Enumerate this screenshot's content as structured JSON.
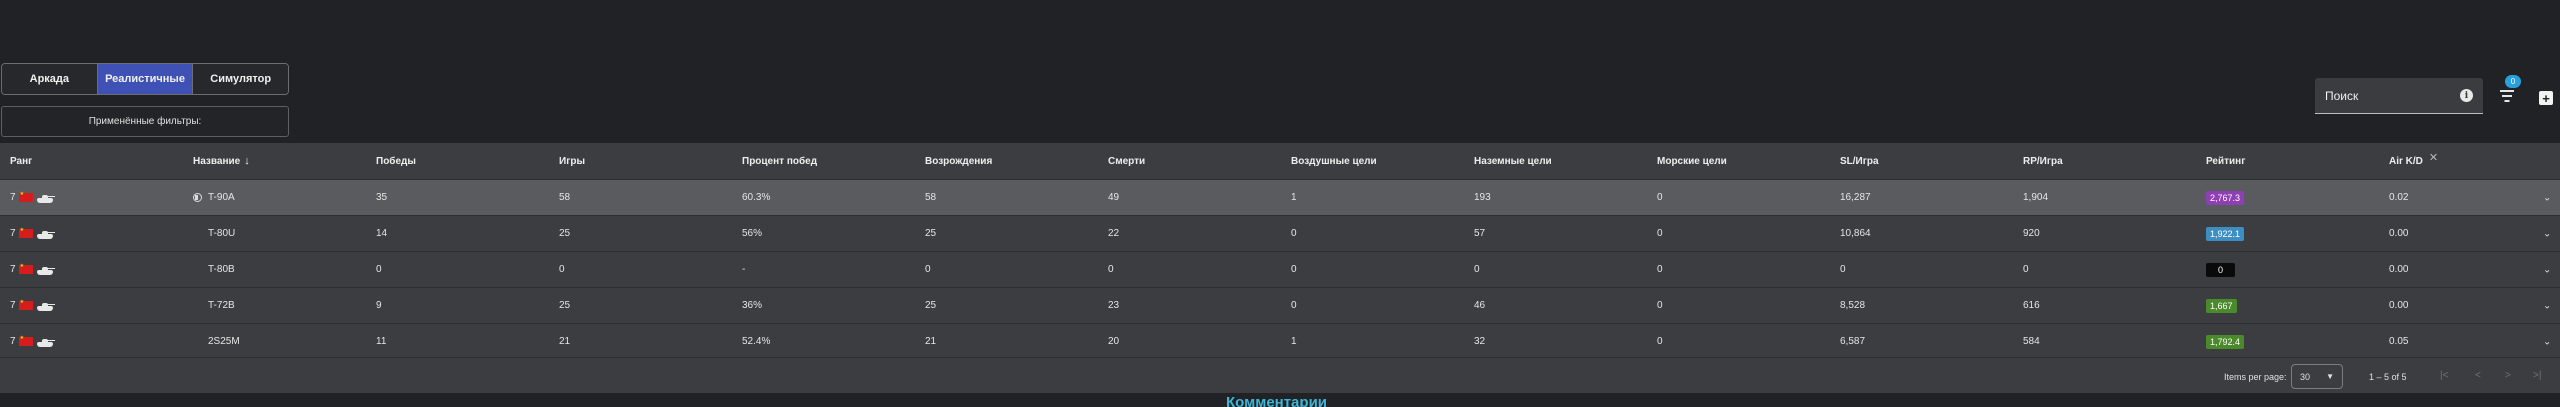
{
  "mode_tabs": [
    {
      "label": "Аркада",
      "active": false
    },
    {
      "label": "Реалистичные",
      "active": true
    },
    {
      "label": "Симулятор",
      "active": false
    }
  ],
  "filters": {
    "label": "Применённые фильтры:"
  },
  "search": {
    "placeholder": "Поиск",
    "info_icon": "i"
  },
  "filter_badge": "0",
  "table": {
    "columns": {
      "rank": "Ранг",
      "name": "Название",
      "wins": "Победы",
      "games": "Игры",
      "win_rate": "Процент побед",
      "respawns": "Возрождения",
      "deaths": "Смерти",
      "air_targets": "Воздушные цели",
      "ground_targets": "Наземные цели",
      "naval_targets": "Морские цели",
      "sl_game": "SL/Игра",
      "rp_game": "RP/Игра",
      "rating": "Рейтинг",
      "air_kd": "Air K/D"
    },
    "rows": [
      {
        "rank": "7",
        "name": "T-90A",
        "wins": "35",
        "games": "58",
        "win_rate": "60.3%",
        "respawns": "58",
        "deaths": "49",
        "air": "1",
        "ground": "193",
        "naval": "0",
        "sl": "16,287",
        "rp": "1,904",
        "rating": "2,767.3",
        "rating_color": "#8e3fb3",
        "air_kd": "0.02"
      },
      {
        "rank": "7",
        "name": "T-80U",
        "wins": "14",
        "games": "25",
        "win_rate": "56%",
        "respawns": "25",
        "deaths": "22",
        "air": "0",
        "ground": "57",
        "naval": "0",
        "sl": "10,864",
        "rp": "920",
        "rating": "1,922.1",
        "rating_color": "#3d8ec2",
        "air_kd": "0.00"
      },
      {
        "rank": "7",
        "name": "T-80B",
        "wins": "0",
        "games": "0",
        "win_rate": "-",
        "respawns": "0",
        "deaths": "0",
        "air": "0",
        "ground": "0",
        "naval": "0",
        "sl": "0",
        "rp": "0",
        "rating": "0",
        "rating_color": "#0a0a0a",
        "air_kd": "0.00"
      },
      {
        "rank": "7",
        "name": "T-72B",
        "wins": "9",
        "games": "25",
        "win_rate": "36%",
        "respawns": "25",
        "deaths": "23",
        "air": "0",
        "ground": "46",
        "naval": "0",
        "sl": "8,528",
        "rp": "616",
        "rating": "1,667",
        "rating_color": "#4a8a2a",
        "air_kd": "0.00"
      },
      {
        "rank": "7",
        "name": "2S25M",
        "wins": "11",
        "games": "21",
        "win_rate": "52.4%",
        "respawns": "21",
        "deaths": "20",
        "air": "1",
        "ground": "32",
        "naval": "0",
        "sl": "6,587",
        "rp": "584",
        "rating": "1,792.4",
        "rating_color": "#4a8a2a",
        "air_kd": "0.05"
      }
    ]
  },
  "paginator": {
    "items_per_page_label": "Items per page:",
    "items_per_page_value": "30",
    "range": "1 – 5 of 5"
  },
  "comments_heading": "Комментарии"
}
